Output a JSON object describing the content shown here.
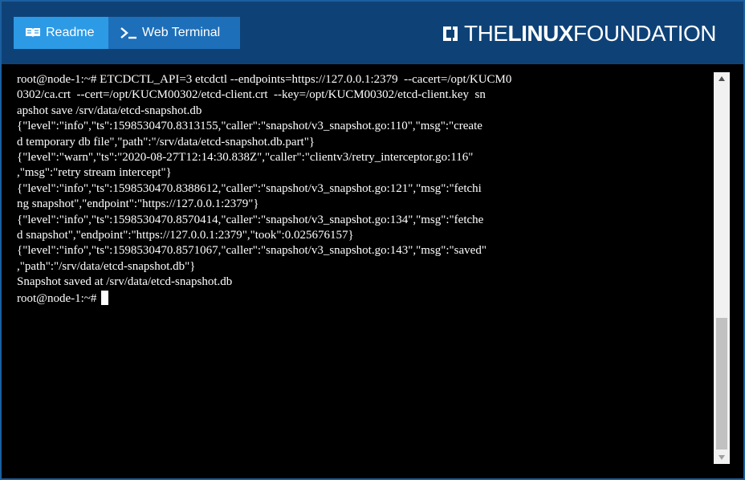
{
  "tabs": [
    {
      "label": "Readme",
      "icon": "book-icon",
      "active": true
    },
    {
      "label": "Web Terminal",
      "icon": "terminal-icon",
      "active": false
    }
  ],
  "brand": {
    "prefix": "THE",
    "bold": "LINUX",
    "suffix": "FOUNDATION"
  },
  "terminal": {
    "lines": [
      "root@node-1:~# ETCDCTL_API=3 etcdctl --endpoints=https://127.0.0.1:2379  --cacert=/opt/KUCM0",
      "0302/ca.crt  --cert=/opt/KUCM00302/etcd-client.crt  --key=/opt/KUCM00302/etcd-client.key  sn",
      "apshot save /srv/data/etcd-snapshot.db",
      "{\"level\":\"info\",\"ts\":1598530470.8313155,\"caller\":\"snapshot/v3_snapshot.go:110\",\"msg\":\"create",
      "d temporary db file\",\"path\":\"/srv/data/etcd-snapshot.db.part\"}",
      "{\"level\":\"warn\",\"ts\":\"2020-08-27T12:14:30.838Z\",\"caller\":\"clientv3/retry_interceptor.go:116\"",
      ",\"msg\":\"retry stream intercept\"}",
      "{\"level\":\"info\",\"ts\":1598530470.8388612,\"caller\":\"snapshot/v3_snapshot.go:121\",\"msg\":\"fetchi",
      "ng snapshot\",\"endpoint\":\"https://127.0.0.1:2379\"}",
      "{\"level\":\"info\",\"ts\":1598530470.8570414,\"caller\":\"snapshot/v3_snapshot.go:134\",\"msg\":\"fetche",
      "d snapshot\",\"endpoint\":\"https://127.0.0.1:2379\",\"took\":0.025676157}",
      "{\"level\":\"info\",\"ts\":1598530470.8571067,\"caller\":\"snapshot/v3_snapshot.go:143\",\"msg\":\"saved\"",
      ",\"path\":\"/srv/data/etcd-snapshot.db\"}",
      "Snapshot saved at /srv/data/etcd-snapshot.db"
    ],
    "prompt": "root@node-1:~# "
  },
  "colors": {
    "header_bg": "#0e4277",
    "tab_active": "#2d9ae6",
    "tab_inactive": "#1e6fb9",
    "terminal_bg": "#000000",
    "terminal_fg": "#ffffff"
  }
}
